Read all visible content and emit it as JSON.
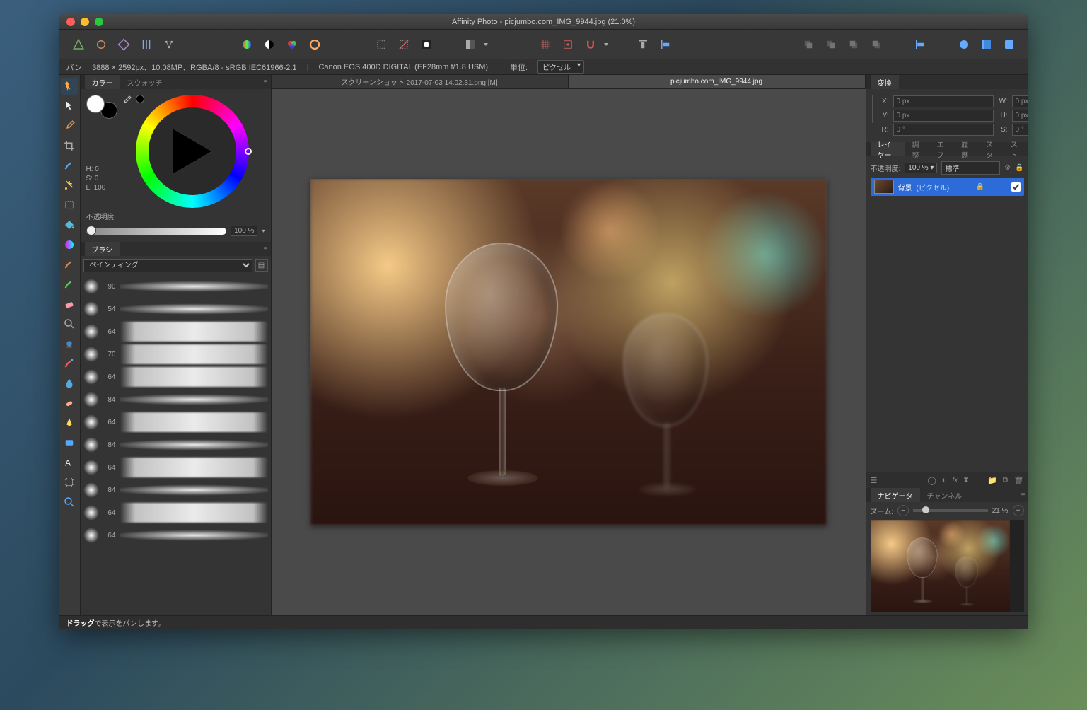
{
  "window_title": "Affinity Photo - picjumbo.com_IMG_9944.jpg (21.0%)",
  "context": {
    "tool": "パン",
    "dims": "3888 × 2592px、10.08MP、RGBA/8 - sRGB IEC61966-2.1",
    "camera": "Canon EOS 400D DIGITAL (EF28mm f/1.8 USM)",
    "unit_label": "単位:",
    "unit_value": "ピクセル"
  },
  "docTabs": [
    {
      "label": "スクリーンショット 2017-07-03 14.02.31.png [M]",
      "active": false
    },
    {
      "label": "picjumbo.com_IMG_9944.jpg",
      "active": true
    }
  ],
  "colorPanel": {
    "tab1": "カラー",
    "tab2": "スウォッチ",
    "h": "H: 0",
    "s": "S: 0",
    "l": "L: 100",
    "opacity_label": "不透明度",
    "opacity_value": "100 %"
  },
  "brushPanel": {
    "tab": "ブラシ",
    "category": "ペインティング",
    "sizes": [
      90,
      54,
      64,
      70,
      64,
      84,
      64,
      84,
      64,
      84,
      64,
      64
    ]
  },
  "transformPanel": {
    "tab": "変換",
    "x_label": "X:",
    "x": "0 px",
    "y_label": "Y:",
    "y": "0 px",
    "w_label": "W:",
    "w": "0 px",
    "h_label": "H:",
    "h": "0 px",
    "r_label": "R:",
    "r": "0 °",
    "s_label": "S:",
    "s": "0 °"
  },
  "layersPanel": {
    "tabs": [
      "レイヤー",
      "調整",
      "エフ",
      "履歴",
      "スタ",
      "スト"
    ],
    "opacity_label": "不透明度:",
    "opacity": "100 %",
    "blend": "標準",
    "layer_name": "背景",
    "layer_type": "(ピクセル)"
  },
  "navPanel": {
    "tabs": [
      "ナビゲータ",
      "チャンネル"
    ],
    "zoom_label": "ズーム:",
    "zoom_value": "21 %"
  },
  "status": {
    "bold": "ドラッグ",
    "rest": "で表示をパンします。"
  }
}
